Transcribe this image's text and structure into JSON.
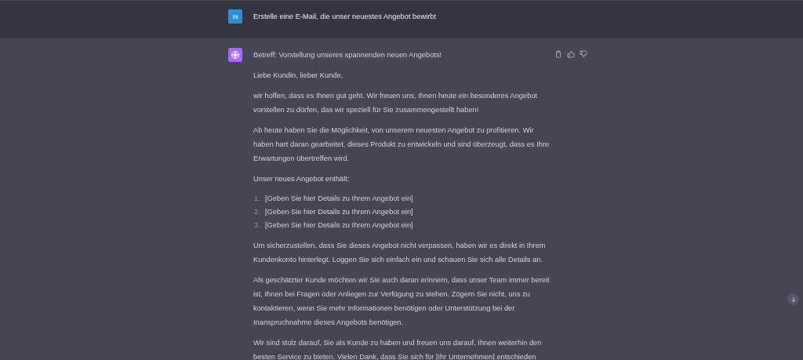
{
  "user_message": {
    "avatar": "IN",
    "text": "Erstelle eine E-Mail, die unser neuestes Angebot bewirbt"
  },
  "assistant_message": {
    "paragraphs": [
      {
        "kind": "text",
        "lines": [
          "Betreff: Vorstellung unseres spannenden neuen Angebots!"
        ]
      },
      {
        "kind": "text",
        "lines": [
          "Liebe Kundin, lieber Kunde,"
        ]
      },
      {
        "kind": "text",
        "lines": [
          "wir hoffen, dass es Ihnen gut geht. Wir freuen uns, Ihnen heute ein besonderes Angebot",
          "vorstellen zu dürfen, das wir speziell für Sie zusammengestellt haben!"
        ]
      },
      {
        "kind": "text",
        "lines": [
          "Ab heute haben Sie die Möglichkeit, von unserem neuesten Angebot zu profitieren. Wir",
          "haben hart daran gearbeitet, dieses Produkt zu entwickeln und sind überzeugt, dass es Ihre",
          "Erwartungen übertreffen wird."
        ]
      },
      {
        "kind": "text",
        "lines": [
          "Unser neues Angebot enthält:"
        ]
      },
      {
        "kind": "list",
        "items": [
          {
            "number": "1.",
            "text": "[Geben Sie hier Details zu Ihrem Angebot ein]"
          },
          {
            "number": "2.",
            "text": "[Geben Sie hier Details zu Ihrem Angebot ein]"
          },
          {
            "number": "3.",
            "text": "[Geben Sie hier Details zu Ihrem Angebot ein]"
          }
        ]
      },
      {
        "kind": "text",
        "lines": [
          "Um sicherzustellen, dass Sie dieses Angebot nicht verpassen, haben wir es direkt in Ihrem",
          "Kundenkonto hinterlegt. Loggen Sie sich einfach ein und schauen Sie sich alle Details an."
        ]
      },
      {
        "kind": "text",
        "lines": [
          "Als geschätzter Kunde möchten wir Sie auch daran erinnern, dass unser Team immer bereit",
          "ist, Ihnen bei Fragen oder Anliegen zur Verfügung zu stehen. Zögern Sie nicht, uns zu",
          "kontaktieren, wenn Sie mehr Informationen benötigen oder Unterstützung bei der",
          "Inanspruchnahme dieses Angebots benötigen."
        ]
      },
      {
        "kind": "text",
        "lines": [
          "Wir sind stolz darauf, Sie als Kunde zu haben und freuen uns darauf, Ihnen weiterhin den",
          "besten Service zu bieten. Vielen Dank, dass Sie sich für [Ihr Unternehmen] entschieden"
        ]
      }
    ]
  }
}
